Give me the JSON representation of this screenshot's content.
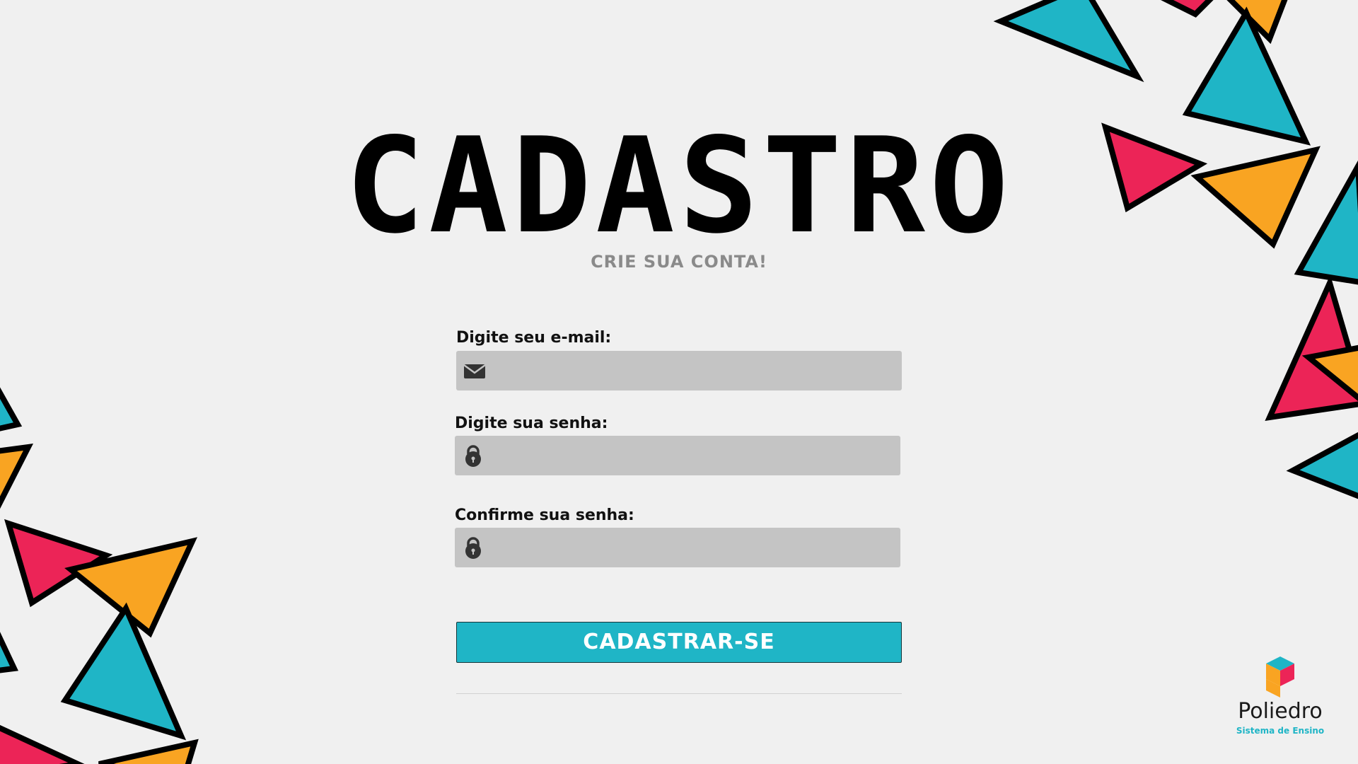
{
  "page": {
    "title": "CADASTRO",
    "subtitle": "CRIE SUA CONTA!"
  },
  "form": {
    "email_label": "Digite seu e-mail:",
    "email_value": "",
    "email_icon": "envelope-icon",
    "password_label": "Digite sua senha:",
    "password_value": "",
    "password_icon": "lock-icon",
    "confirm_label": "Confirme sua senha:",
    "confirm_value": "",
    "confirm_icon": "lock-icon",
    "submit_label": "CADASTRAR-SE"
  },
  "logo": {
    "name": "Poliedro",
    "tagline": "Sistema de Ensino"
  },
  "colors": {
    "background": "#f0f0f0",
    "accent_teal": "#1fb5c6",
    "accent_pink": "#ec2457",
    "accent_orange": "#f9a422",
    "field_bg": "#c4c4c4",
    "outline": "#000000"
  }
}
